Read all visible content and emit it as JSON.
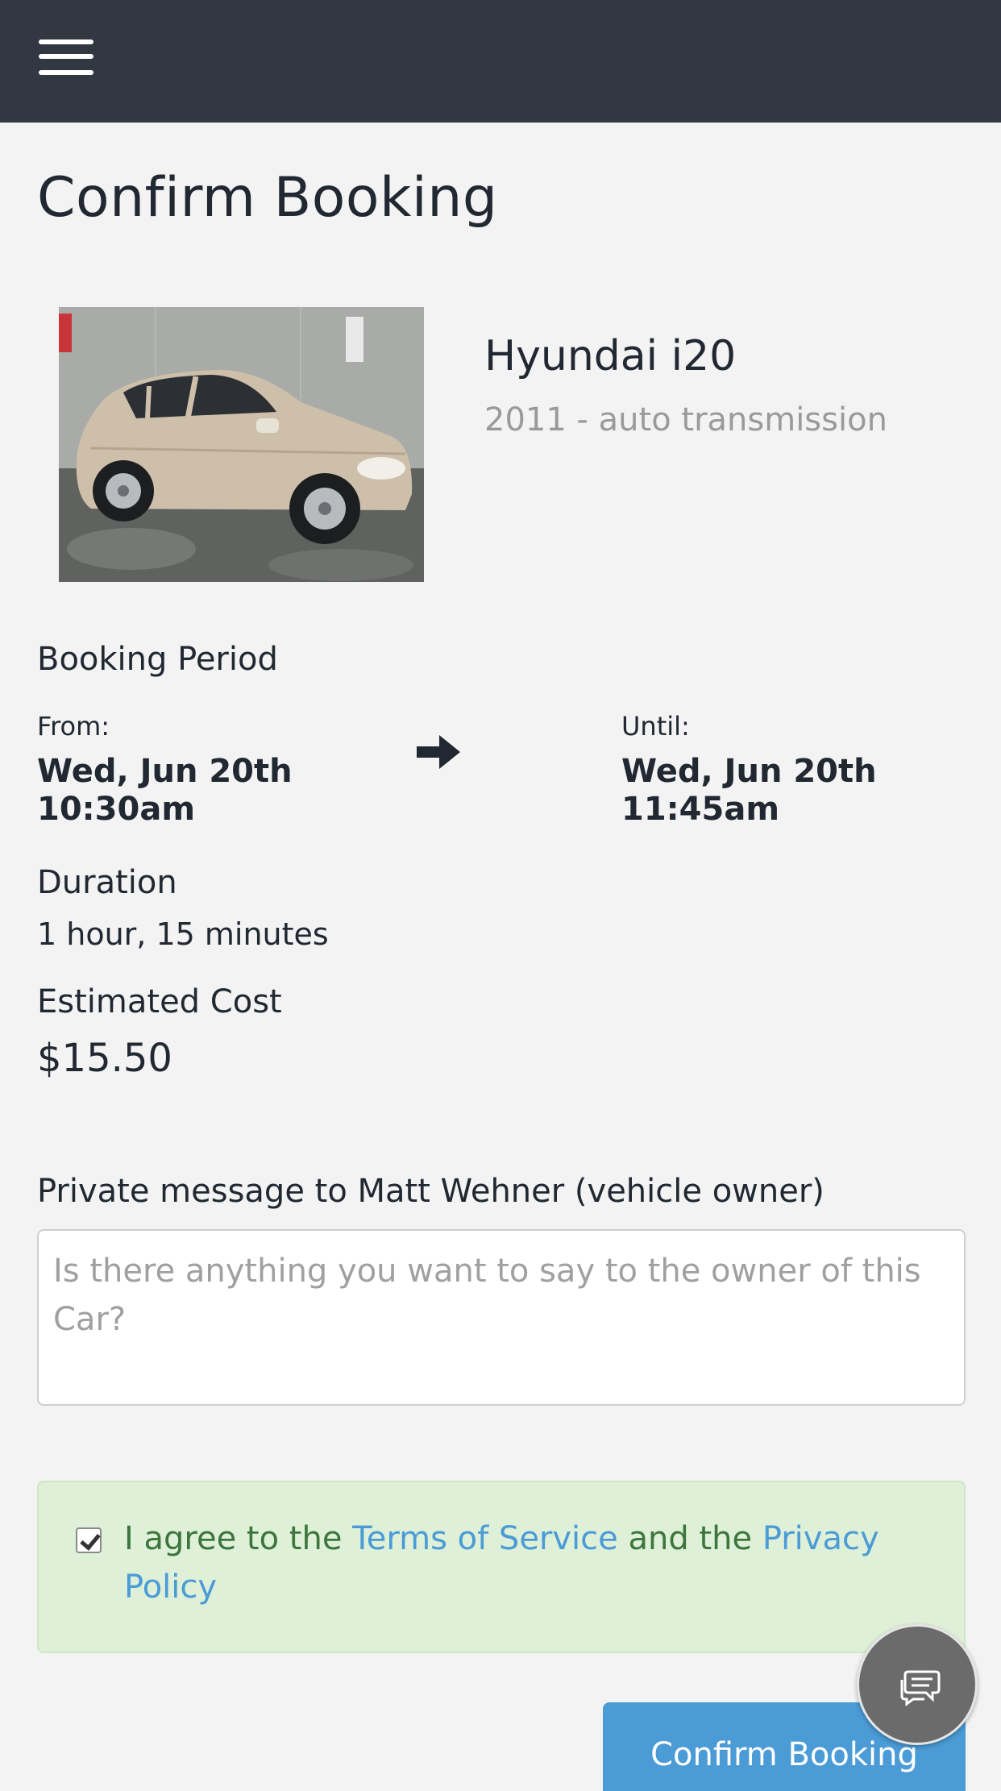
{
  "header": {
    "menu_icon": "hamburger-menu-icon"
  },
  "page": {
    "title": "Confirm Booking"
  },
  "vehicle": {
    "name": "Hyundai i20",
    "subtitle": "2011 - auto transmission",
    "photo_alt": "Hyundai i20"
  },
  "booking": {
    "period_label": "Booking Period",
    "from_label": "From:",
    "from_date": "Wed, Jun 20th",
    "from_time": "10:30am",
    "until_label": "Until:",
    "until_date": "Wed, Jun 20th",
    "until_time": "11:45am",
    "arrow_icon": "arrow-right-icon",
    "duration_label": "Duration",
    "duration_value": "1 hour, 15 minutes",
    "cost_label": "Estimated Cost",
    "cost_value": "$15.50"
  },
  "message": {
    "label": "Private message to Matt Wehner (vehicle owner)",
    "placeholder": "Is there anything you want to say to the owner of this Car?",
    "value": ""
  },
  "agreement": {
    "checked": true,
    "prefix": "I agree to the ",
    "terms_link": "Terms of Service",
    "middle": " and the ",
    "privacy_link": "Privacy Policy"
  },
  "chat": {
    "icon": "chat-bubbles-icon"
  },
  "actions": {
    "confirm_label": "Confirm Booking"
  },
  "colors": {
    "topbar": "#313842",
    "background": "#f3f3f3",
    "accent": "#4a9bd6",
    "success_bg": "#dff0d8",
    "success_text": "#3c763d",
    "muted": "#9a9a9a"
  }
}
